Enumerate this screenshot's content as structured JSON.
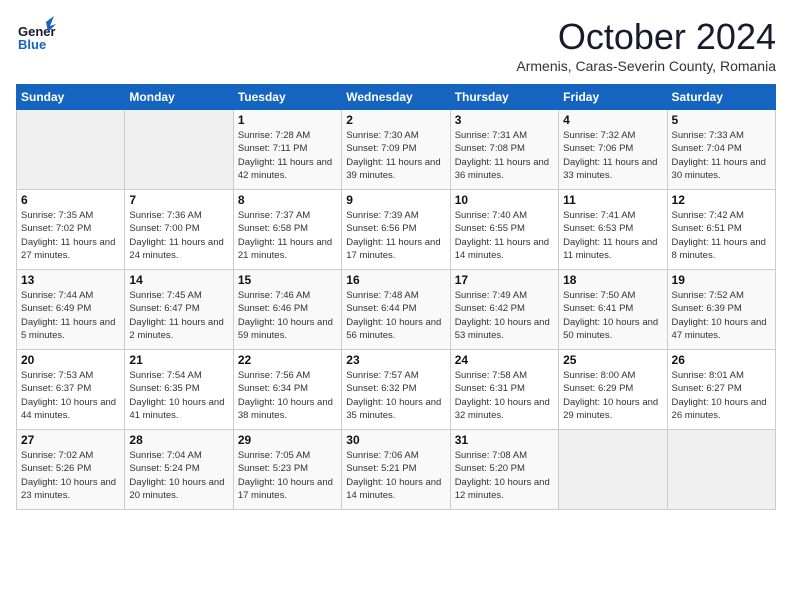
{
  "logo": {
    "line1": "General",
    "line2": "Blue"
  },
  "title": "October 2024",
  "subtitle": "Armenis, Caras-Severin County, Romania",
  "headers": [
    "Sunday",
    "Monday",
    "Tuesday",
    "Wednesday",
    "Thursday",
    "Friday",
    "Saturday"
  ],
  "weeks": [
    [
      {
        "day": "",
        "info": ""
      },
      {
        "day": "",
        "info": ""
      },
      {
        "day": "1",
        "info": "Sunrise: 7:28 AM\nSunset: 7:11 PM\nDaylight: 11 hours and 42 minutes."
      },
      {
        "day": "2",
        "info": "Sunrise: 7:30 AM\nSunset: 7:09 PM\nDaylight: 11 hours and 39 minutes."
      },
      {
        "day": "3",
        "info": "Sunrise: 7:31 AM\nSunset: 7:08 PM\nDaylight: 11 hours and 36 minutes."
      },
      {
        "day": "4",
        "info": "Sunrise: 7:32 AM\nSunset: 7:06 PM\nDaylight: 11 hours and 33 minutes."
      },
      {
        "day": "5",
        "info": "Sunrise: 7:33 AM\nSunset: 7:04 PM\nDaylight: 11 hours and 30 minutes."
      }
    ],
    [
      {
        "day": "6",
        "info": "Sunrise: 7:35 AM\nSunset: 7:02 PM\nDaylight: 11 hours and 27 minutes."
      },
      {
        "day": "7",
        "info": "Sunrise: 7:36 AM\nSunset: 7:00 PM\nDaylight: 11 hours and 24 minutes."
      },
      {
        "day": "8",
        "info": "Sunrise: 7:37 AM\nSunset: 6:58 PM\nDaylight: 11 hours and 21 minutes."
      },
      {
        "day": "9",
        "info": "Sunrise: 7:39 AM\nSunset: 6:56 PM\nDaylight: 11 hours and 17 minutes."
      },
      {
        "day": "10",
        "info": "Sunrise: 7:40 AM\nSunset: 6:55 PM\nDaylight: 11 hours and 14 minutes."
      },
      {
        "day": "11",
        "info": "Sunrise: 7:41 AM\nSunset: 6:53 PM\nDaylight: 11 hours and 11 minutes."
      },
      {
        "day": "12",
        "info": "Sunrise: 7:42 AM\nSunset: 6:51 PM\nDaylight: 11 hours and 8 minutes."
      }
    ],
    [
      {
        "day": "13",
        "info": "Sunrise: 7:44 AM\nSunset: 6:49 PM\nDaylight: 11 hours and 5 minutes."
      },
      {
        "day": "14",
        "info": "Sunrise: 7:45 AM\nSunset: 6:47 PM\nDaylight: 11 hours and 2 minutes."
      },
      {
        "day": "15",
        "info": "Sunrise: 7:46 AM\nSunset: 6:46 PM\nDaylight: 10 hours and 59 minutes."
      },
      {
        "day": "16",
        "info": "Sunrise: 7:48 AM\nSunset: 6:44 PM\nDaylight: 10 hours and 56 minutes."
      },
      {
        "day": "17",
        "info": "Sunrise: 7:49 AM\nSunset: 6:42 PM\nDaylight: 10 hours and 53 minutes."
      },
      {
        "day": "18",
        "info": "Sunrise: 7:50 AM\nSunset: 6:41 PM\nDaylight: 10 hours and 50 minutes."
      },
      {
        "day": "19",
        "info": "Sunrise: 7:52 AM\nSunset: 6:39 PM\nDaylight: 10 hours and 47 minutes."
      }
    ],
    [
      {
        "day": "20",
        "info": "Sunrise: 7:53 AM\nSunset: 6:37 PM\nDaylight: 10 hours and 44 minutes."
      },
      {
        "day": "21",
        "info": "Sunrise: 7:54 AM\nSunset: 6:35 PM\nDaylight: 10 hours and 41 minutes."
      },
      {
        "day": "22",
        "info": "Sunrise: 7:56 AM\nSunset: 6:34 PM\nDaylight: 10 hours and 38 minutes."
      },
      {
        "day": "23",
        "info": "Sunrise: 7:57 AM\nSunset: 6:32 PM\nDaylight: 10 hours and 35 minutes."
      },
      {
        "day": "24",
        "info": "Sunrise: 7:58 AM\nSunset: 6:31 PM\nDaylight: 10 hours and 32 minutes."
      },
      {
        "day": "25",
        "info": "Sunrise: 8:00 AM\nSunset: 6:29 PM\nDaylight: 10 hours and 29 minutes."
      },
      {
        "day": "26",
        "info": "Sunrise: 8:01 AM\nSunset: 6:27 PM\nDaylight: 10 hours and 26 minutes."
      }
    ],
    [
      {
        "day": "27",
        "info": "Sunrise: 7:02 AM\nSunset: 5:26 PM\nDaylight: 10 hours and 23 minutes."
      },
      {
        "day": "28",
        "info": "Sunrise: 7:04 AM\nSunset: 5:24 PM\nDaylight: 10 hours and 20 minutes."
      },
      {
        "day": "29",
        "info": "Sunrise: 7:05 AM\nSunset: 5:23 PM\nDaylight: 10 hours and 17 minutes."
      },
      {
        "day": "30",
        "info": "Sunrise: 7:06 AM\nSunset: 5:21 PM\nDaylight: 10 hours and 14 minutes."
      },
      {
        "day": "31",
        "info": "Sunrise: 7:08 AM\nSunset: 5:20 PM\nDaylight: 10 hours and 12 minutes."
      },
      {
        "day": "",
        "info": ""
      },
      {
        "day": "",
        "info": ""
      }
    ]
  ]
}
